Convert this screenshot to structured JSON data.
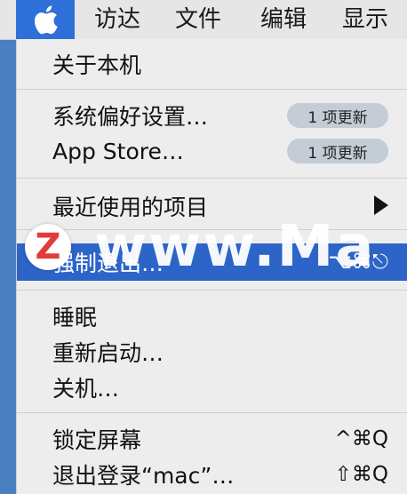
{
  "menubar": {
    "apple_icon": "apple-logo",
    "items": [
      "访达",
      "文件",
      "编辑",
      "显示"
    ]
  },
  "apple_menu": {
    "about": "关于本机",
    "system_prefs": "系统偏好设置…",
    "system_prefs_badge": "1 项更新",
    "app_store": "App Store…",
    "app_store_badge": "1 项更新",
    "recent_items": "最近使用的项目",
    "force_quit": "强制退出…",
    "force_quit_shortcut": "⌥⌘⎋",
    "sleep": "睡眠",
    "restart": "重新启动…",
    "shutdown": "关机…",
    "lock_screen": "锁定屏幕",
    "lock_screen_shortcut": "^⌘Q",
    "logout": "退出登录“mac”…",
    "logout_shortcut": "⇧⌘Q"
  },
  "watermark": {
    "logo_letter": "Z",
    "text": "www.Ma"
  },
  "colors": {
    "menubar_bg": "#e6e6e6",
    "menu_bg": "#ededed",
    "highlight": "#2d64c8",
    "badge_bg": "#c4ccd6",
    "desktop": "#4a7fc1"
  }
}
